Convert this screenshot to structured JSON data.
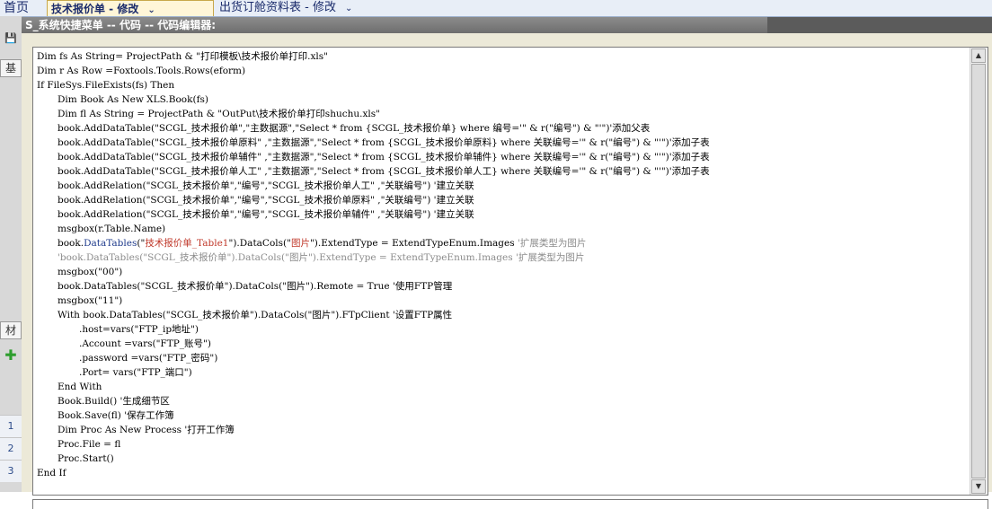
{
  "app_tabs": {
    "home": "首页",
    "active": "技术报价单 - 修改",
    "second": "出货订舱资料表 - 修改"
  },
  "left_strip": {
    "tab_top": "基",
    "tab_mid": "材",
    "rows": [
      "1",
      "2",
      "3"
    ]
  },
  "dialog": {
    "title": "S_系统快捷菜单 -- 代码 -- 代码编辑器:"
  },
  "code": {
    "l01": "Dim fs As String= ProjectPath & \"打印模板\\技术报价单打印.xls\"",
    "l02": "Dim r As Row =Foxtools.Tools.Rows(eform)",
    "l03": "If FileSys.FileExists(fs) Then",
    "l04": "Dim Book As New XLS.Book(fs)",
    "l05": "Dim fl As String = ProjectPath & \"OutPut\\技术报价单打印shuchu.xls\"",
    "l06": "book.AddDataTable(\"SCGL_技术报价单\",\"主数据源\",\"Select * from {SCGL_技术报价单} where 编号='\" & r(\"编号\") & \"'\")'添加父表",
    "l07": "book.AddDataTable(\"SCGL_技术报价单原料\" ,\"主数据源\",\"Select * from {SCGL_技术报价单原料} where 关联编号='\" & r(\"编号\") & \"'\")'添加子表",
    "l08": "book.AddDataTable(\"SCGL_技术报价单辅件\" ,\"主数据源\",\"Select * from {SCGL_技术报价单辅件} where 关联编号='\" & r(\"编号\") & \"'\")'添加子表",
    "l09": "book.AddDataTable(\"SCGL_技术报价单人工\" ,\"主数据源\",\"Select * from {SCGL_技术报价单人工} where 关联编号='\" & r(\"编号\") & \"'\")'添加子表",
    "l10": "book.AddRelation(\"SCGL_技术报价单\",\"编号\",\"SCGL_技术报价单人工\" ,\"关联编号\") '建立关联",
    "l11": "book.AddRelation(\"SCGL_技术报价单\",\"编号\",\"SCGL_技术报价单原料\" ,\"关联编号\") '建立关联",
    "l12": "book.AddRelation(\"SCGL_技术报价单\",\"编号\",\"SCGL_技术报价单辅件\" ,\"关联编号\") '建立关联",
    "l13": "msgbox(r.Table.Name)",
    "l14_a": "book.",
    "l14_b": "DataTables",
    "l14_c": "(\"",
    "l14_d": "技术报价单_Table1",
    "l14_e": "\").DataCols(\"",
    "l14_f": "图片",
    "l14_g": "\").ExtendType = ExtendTypeEnum.Images ",
    "l14_h": "'扩展类型为图片",
    "l15": "'book.DataTables(\"SCGL_技术报价单\").DataCols(\"图片\").ExtendType = ExtendTypeEnum.Images '扩展类型为图片",
    "l16": "msgbox(\"00\")",
    "l17": "book.DataTables(\"SCGL_技术报价单\").DataCols(\"图片\").Remote = True '使用FTP管理",
    "l18": "msgbox(\"11\")",
    "l19": "With book.DataTables(\"SCGL_技术报价单\").DataCols(\"图片\").FTpClient '设置FTP属性",
    "l20": ".host=vars(\"FTP_ip地址\")",
    "l21": ".Account =vars(\"FTP_账号\")",
    "l22": ".password =vars(\"FTP_密码\")",
    "l23": ".Port= vars(\"FTP_端口\")",
    "l24": "End With",
    "l25": "Book.Build() '生成细节区",
    "l26": "Book.Save(fl) '保存工作簿",
    "l27": "Dim Proc As New Process '打开工作簿",
    "l28": "Proc.File = fl",
    "l29": "Proc.Start()",
    "l30": "End If"
  },
  "scrollbar": {
    "up_icon": "▲",
    "down_icon": "▼"
  },
  "colors": {
    "string_red": "#c0392b",
    "keyword_blue": "#1f3b8c",
    "comment_gray": "#8c8c8c",
    "title_bar": "#7a7a7a"
  }
}
